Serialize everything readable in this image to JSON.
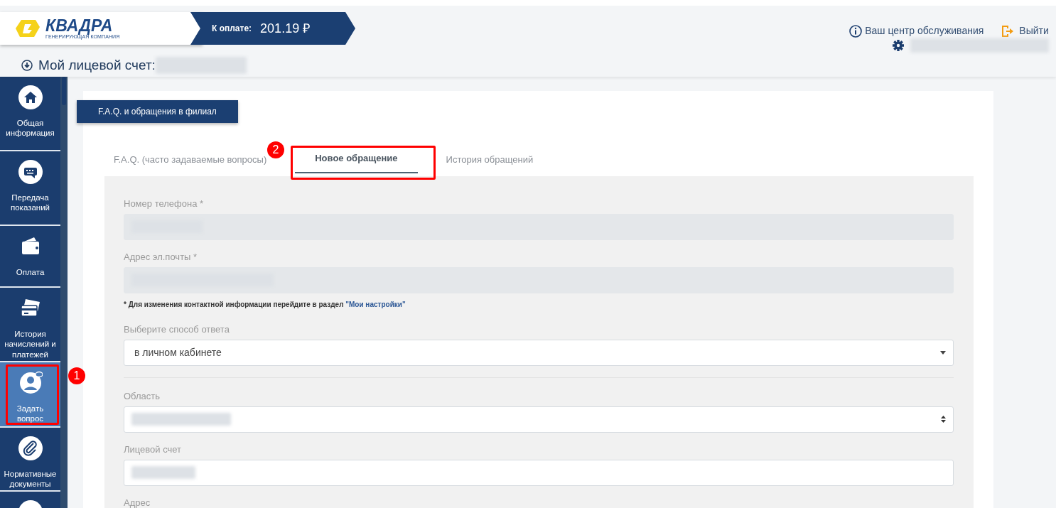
{
  "header": {
    "logo": {
      "name": "КВАДРА",
      "tagline": "ГЕНЕРИРУЮЩАЯ КОМПАНИЯ"
    },
    "payment": {
      "label": "К оплате:",
      "amount": "201.19 ₽"
    },
    "service_center": "Ваш центр обслуживания",
    "logout": "Выйти",
    "user_redacted": true,
    "account": {
      "label": "Мой лицевой счет:",
      "redacted": true
    }
  },
  "sidebar": {
    "items": [
      {
        "label": "Общая информация",
        "kind": "home",
        "selected": false
      },
      {
        "label": "Передача показаний",
        "kind": "meter",
        "selected": false
      },
      {
        "label": "Оплата",
        "kind": "wallet",
        "selected": false
      },
      {
        "label": "История начислений и платежей",
        "kind": "cards",
        "selected": false
      },
      {
        "label": "Задать вопрос",
        "kind": "question",
        "selected": true,
        "annotation": "1"
      },
      {
        "label": "Нормативные документы",
        "kind": "clip",
        "selected": false
      },
      {
        "kind": "partial",
        "selected": false
      }
    ]
  },
  "section_title": "F.A.Q. и обращения в филиал",
  "tabs": [
    {
      "label": "F.A.Q. (часто задаваемые вопросы)",
      "selected": false
    },
    {
      "label": "Новое обращение",
      "selected": true,
      "annotation": "2"
    },
    {
      "label": "История обращений",
      "selected": false
    }
  ],
  "form": {
    "fields": [
      {
        "kind": "input",
        "label": "Номер телефона *",
        "disabled": true,
        "redacted": true
      },
      {
        "kind": "input",
        "label": "Адрес эл.почты *",
        "disabled": true,
        "redacted": true,
        "note": {
          "text": "* Для изменения контактной информации перейдите в раздел ",
          "link": "\"Мои настройки\""
        }
      },
      {
        "kind": "select",
        "label": "Выберите способ ответа",
        "disabled": false,
        "value": "в личном кабинете"
      },
      {
        "kind": "divider"
      },
      {
        "kind": "native-select",
        "label": "Область",
        "disabled": false,
        "redacted": true
      },
      {
        "kind": "input",
        "label": "Лицевой счет",
        "disabled": false,
        "redacted": true
      },
      {
        "kind": "label-only",
        "label": "Адрес"
      }
    ]
  }
}
